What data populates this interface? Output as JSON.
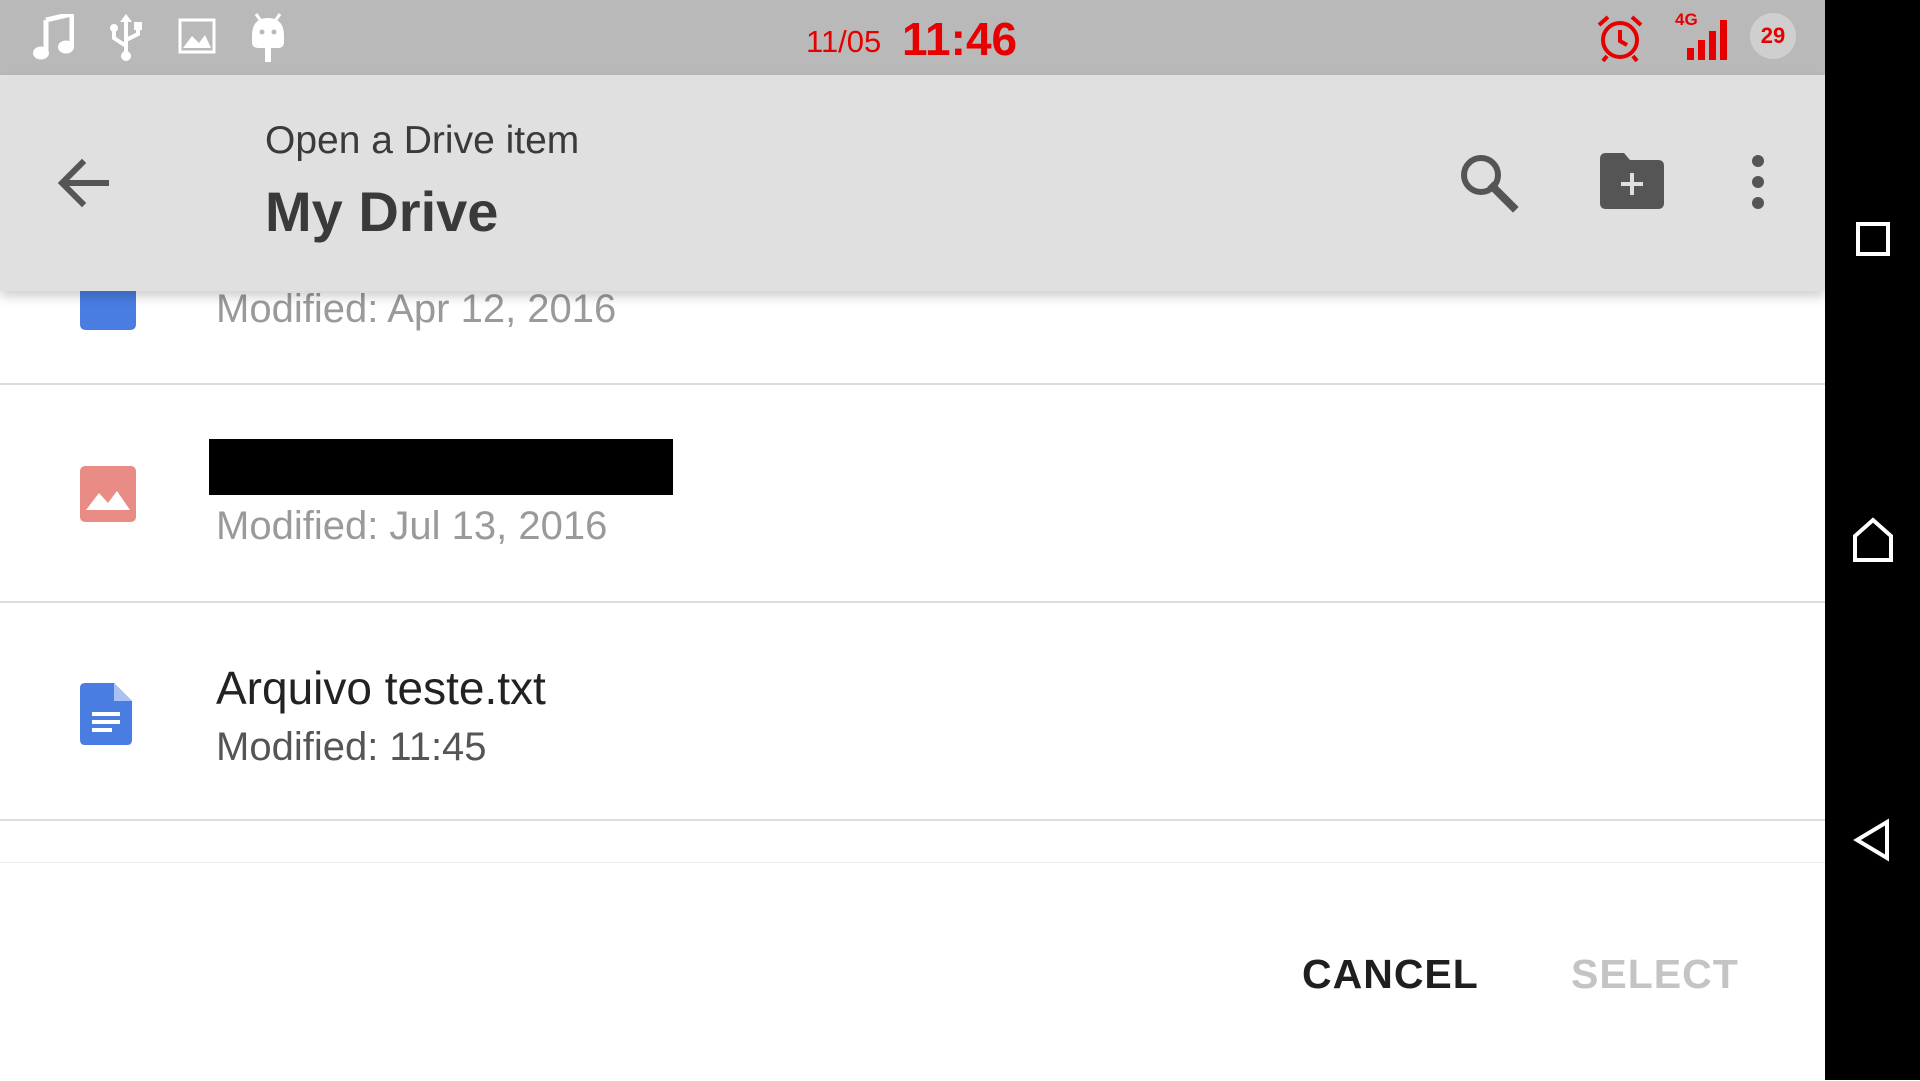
{
  "status_bar": {
    "date": "11/05",
    "time": "11:46",
    "network": "4G",
    "battery": "29",
    "left_icons": [
      "music-icon",
      "usb-icon",
      "image-icon",
      "android-icon"
    ],
    "right_icons": [
      "alarm-icon",
      "signal-icon",
      "battery-icon"
    ],
    "accent_color": "#e60000"
  },
  "app_bar": {
    "subtitle": "Open a Drive item",
    "title": "My Drive",
    "icons": [
      "back-arrow-icon",
      "search-icon",
      "new-folder-icon",
      "more-vert-icon"
    ]
  },
  "files": [
    {
      "name": "",
      "modified": "Modified: Apr 12, 2016",
      "icon": "document-icon",
      "partially_hidden": true
    },
    {
      "name": "",
      "modified": "Modified: Jul 13, 2016",
      "icon": "image-file-icon",
      "name_redacted": true
    },
    {
      "name": "Arquivo teste.txt",
      "modified": "Modified: 11:45",
      "icon": "document-icon"
    }
  ],
  "buttons": {
    "cancel": "CANCEL",
    "select": "SELECT",
    "select_enabled": false
  },
  "nav": {
    "icons": [
      "recents-icon",
      "home-icon",
      "back-triangle-icon"
    ]
  },
  "colors": {
    "doc_blue": "#4a7de2",
    "image_red": "#ea8c86",
    "status_bar": "#b9b9b9",
    "app_bar": "#e0e0e0"
  }
}
